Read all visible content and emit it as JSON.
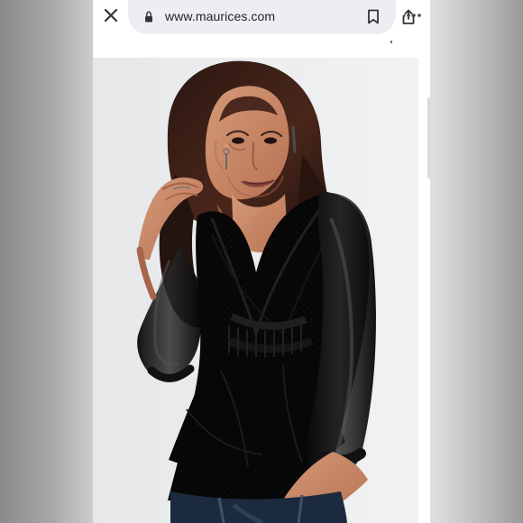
{
  "browser": {
    "url": "www.maurices.com"
  },
  "icons": {
    "close": "close-icon",
    "lock": "lock-icon",
    "bookmark": "bookmark-icon",
    "share": "share-icon",
    "more": "more-icon"
  }
}
